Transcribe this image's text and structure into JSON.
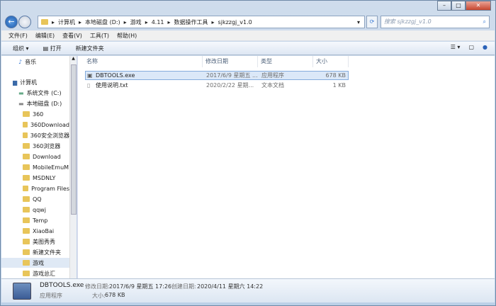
{
  "address": {
    "path": [
      "计算机",
      "本地磁盘 (D:)",
      "游戏",
      "4.11",
      "数据操作工具",
      "sjkzzgj_v1.0"
    ],
    "search_placeholder": "搜索 sjkzzgj_v1.0"
  },
  "menu": [
    "文件(F)",
    "编辑(E)",
    "查看(V)",
    "工具(T)",
    "帮助(H)"
  ],
  "toolbar": {
    "organize": "组织 ▾",
    "open": "打开",
    "new_folder": "新建文件夹"
  },
  "sidebar": {
    "music": "音乐",
    "computer": "计算机",
    "drive_c": "系统文件 (C:)",
    "drive_d": "本地磁盘 (D:)",
    "folders": [
      "360",
      "360Download",
      "360安全浏览器",
      "360浏览器",
      "Download",
      "MobileEmuM",
      "MSDNLY",
      "Program Files",
      "QQ",
      "qqwj",
      "Temp",
      "XiaoBai",
      "美图秀秀",
      "新建文件夹",
      "游戏",
      "游戏总汇"
    ],
    "selected": "游戏"
  },
  "columns": {
    "name": "名称",
    "date": "修改日期",
    "type": "类型",
    "size": "大小"
  },
  "files": [
    {
      "name": "DBTOOLS.exe",
      "date": "2017/6/9 星期五 ...",
      "type": "应用程序",
      "size": "678 KB"
    },
    {
      "name": "使用说明.txt",
      "date": "2020/2/22 星期...",
      "type": "文本文档",
      "size": "1 KB"
    }
  ],
  "status": {
    "name": "DBTOOLS.exe",
    "modified_label": "修改日期:",
    "modified": "2017/6/9 星期五 17:26",
    "created_label": "创建日期:",
    "created": "2020/4/11 星期六 14:22",
    "type": "应用程序",
    "size_label": "大小:",
    "size": "678 KB"
  }
}
